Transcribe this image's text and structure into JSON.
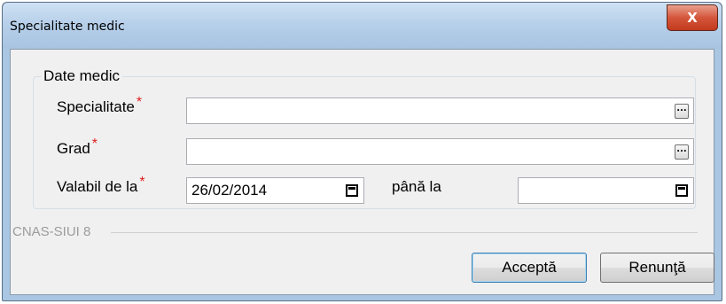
{
  "window": {
    "title": "Specialitate medic",
    "close_label": "X"
  },
  "group": {
    "legend": "Date medic"
  },
  "fields": {
    "specialitate": {
      "label": "Specialitate",
      "required_mark": "*",
      "value": ""
    },
    "grad": {
      "label": "Grad",
      "required_mark": "*",
      "value": ""
    },
    "valabil_de_la": {
      "label": "Valabil de la",
      "required_mark": "*",
      "value": "26/02/2014"
    },
    "pana_la": {
      "label": "până la",
      "value": ""
    }
  },
  "footer": {
    "brand": "CNAS-SIUI 8"
  },
  "buttons": {
    "accept": "Acceptă",
    "cancel": "Renunţă"
  },
  "icons": {
    "ellipsis": "...",
    "calendar": "calendar-icon"
  }
}
